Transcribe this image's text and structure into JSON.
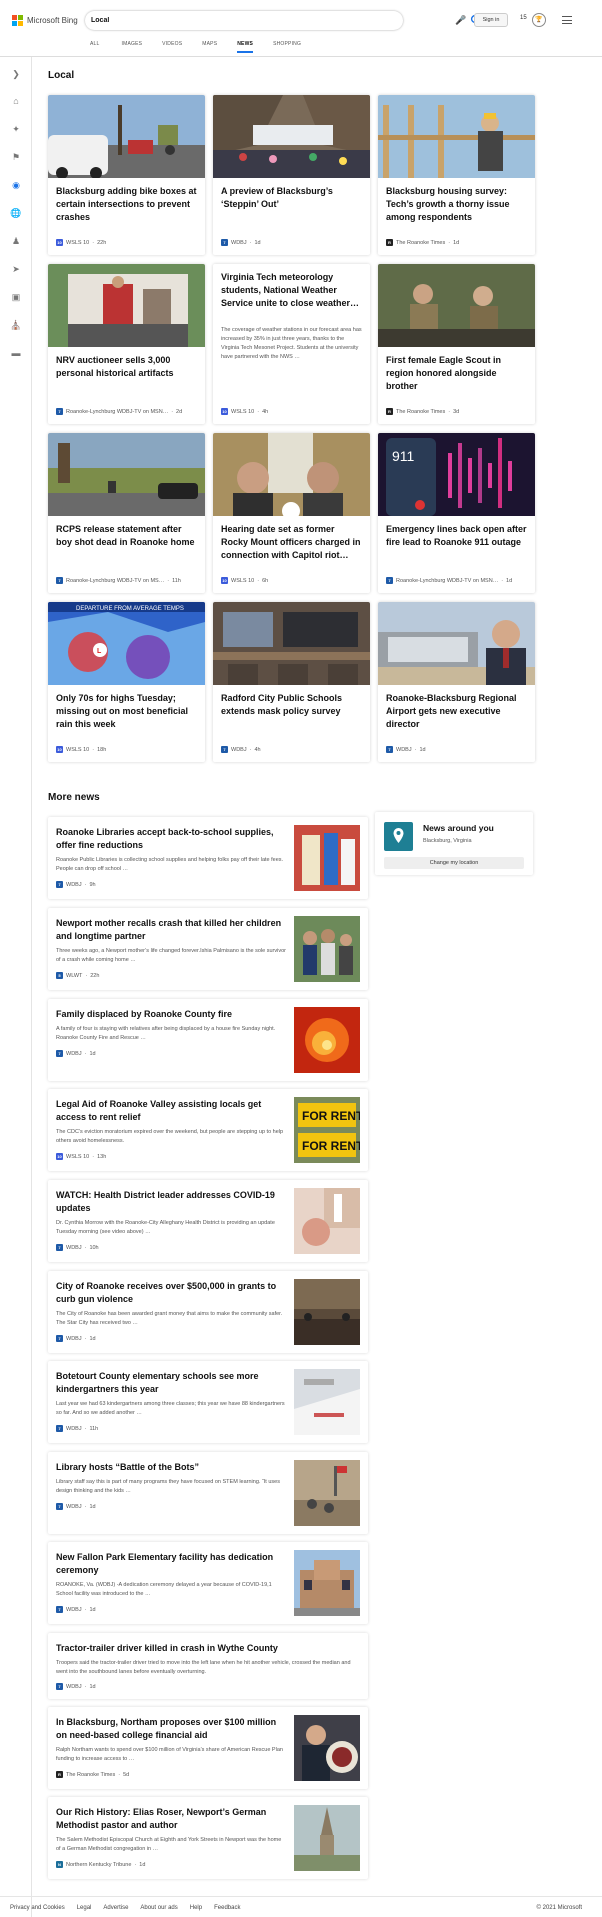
{
  "header": {
    "brand": "Microsoft Bing",
    "query": "Local",
    "signin_label": "Sign in",
    "rewards_count": "15"
  },
  "tabs": [
    "ALL",
    "IMAGES",
    "VIDEOS",
    "MAPS",
    "NEWS",
    "SHOPPING"
  ],
  "active_tab": "NEWS",
  "sidebar": [
    "chevron-right-icon",
    "home-icon",
    "sparkle-icon",
    "flag-icon",
    "location-pin-icon",
    "globe-icon",
    "person-icon",
    "rocket-icon",
    "film-icon",
    "bank-icon",
    "card-icon"
  ],
  "local": {
    "title": "Local",
    "cards": [
      {
        "title": "Blacksburg adding bike boxes at certain intersections to prevent crashes",
        "source": "WSLS 10",
        "time": "22h"
      },
      {
        "title": "A preview of Blacksburg’s ‘Steppin’ Out’",
        "source": "WDBJ",
        "time": "1d"
      },
      {
        "title": "Blacksburg housing survey: Tech’s growth a thorny issue among respondents",
        "source": "The Roanoke Times",
        "time": "1d"
      },
      {
        "title": "NRV auctioneer sells 3,000 personal historical artifacts",
        "source": "Roanoke-Lynchburg WDBJ-TV on MSN…",
        "time": "2d"
      },
      {
        "title": "Virginia Tech meteorology students, National Weather Service unite to close weather…",
        "description": "The coverage of weather stations in our forecast area has increased by 35% in just three years, thanks to the Virginia Tech Mesonet Project. Students at the university have partnered with the NWS …",
        "source": "WSLS 10",
        "time": "4h"
      },
      {
        "title": "First female Eagle Scout in region honored alongside brother",
        "source": "The Roanoke Times",
        "time": "3d"
      },
      {
        "title": "RCPS release statement after boy shot dead in Roanoke home",
        "source": "Roanoke-Lynchburg WDBJ-TV on MS…",
        "time": "11h"
      },
      {
        "title": "Hearing date set as former Rocky Mount officers charged in connection with Capitol riot…",
        "source": "WSLS 10",
        "time": "6h"
      },
      {
        "title": "Emergency lines back open after fire lead to Roanoke 911 outage",
        "source": "Roanoke-Lynchburg WDBJ-TV on MSN…",
        "time": "1d"
      },
      {
        "title": "Only 70s for highs Tuesday; missing out on most beneficial rain this week",
        "source": "WSLS 10",
        "time": "18h",
        "image_text": "DEPARTURE FROM AVERAGE TEMPS"
      },
      {
        "title": "Radford City Public Schools extends mask policy survey",
        "source": "WDBJ",
        "time": "4h"
      },
      {
        "title": "Roanoke-Blacksburg Regional Airport gets new executive director",
        "source": "WDBJ",
        "time": "1d"
      }
    ]
  },
  "more": {
    "title": "More news",
    "items": [
      {
        "title": "Roanoke Libraries accept back-to-school supplies, offer fine reductions",
        "description": "Roanoke Public Libraries is collecting school supplies and helping folks pay off their late fees. People can drop off school …",
        "source": "WDBJ",
        "time": "9h"
      },
      {
        "title": "Newport mother recalls crash that killed her children and longtime partner",
        "description": "Three weeks ago, a Newport mother’s life changed forever.Ishia Palmisano is the sole survivor of a crash while coming home …",
        "source": "WLWT",
        "time": "22h"
      },
      {
        "title": "Family displaced by Roanoke County fire",
        "description": "A family of four is staying with relatives after being displaced by a house fire Sunday night. Roanoke County Fire and Rescue …",
        "source": "WDBJ",
        "time": "1d"
      },
      {
        "title": "Legal Aid of Roanoke Valley assisting locals get access to rent relief",
        "description": "The CDC’s eviction moratorium expired over the weekend, but people are stepping up to help others avoid homelessness.",
        "source": "WSLS 10",
        "time": "13h",
        "image_text": "FOR RENT"
      },
      {
        "title": "WATCH: Health District leader addresses COVID-19 updates",
        "description": "Dr. Cynthia Morrow with the Roanoke-City Alleghany Health District is providing an update Tuesday morning (see video above) …",
        "source": "WDBJ",
        "time": "10h"
      },
      {
        "title": "City of Roanoke receives over $500,000 in grants to curb gun violence",
        "description": "The City of Roanoke has been awarded grant money that aims to make the community safer. The Star City has received two …",
        "source": "WDBJ",
        "time": "1d"
      },
      {
        "title": "Botetourt County elementary schools see more kindergartners this year",
        "description": "Last year we had 63 kindergartners among three classes; this year we have 88 kindergartners so far. And so we added another …",
        "source": "WDBJ",
        "time": "11h"
      },
      {
        "title": "Library hosts “Battle of the Bots”",
        "description": "Library staff say this is part of many programs they have focused on STEM learning. “It uses design thinking and the kids …",
        "source": "WDBJ",
        "time": "1d"
      },
      {
        "title": "New Fallon Park Elementary facility has dedication ceremony",
        "description": "ROANOKE, Va. (WDBJ) -A dedication ceremony delayed a year because of COVID-19,1 School facility was introduced to the …",
        "source": "WDBJ",
        "time": "1d"
      },
      {
        "title": "Tractor-trailer driver killed in crash in Wythe County",
        "description": "Troopers said the tractor-trailer driver tried to move into the left lane when he hit another vehicle, crossed the median and went into the southbound lanes before eventually overturning.",
        "source": "WDBJ",
        "time": "1d"
      },
      {
        "title": "In Blacksburg, Northam proposes over $100 million on need-based college financial aid",
        "description": "Ralph Northam wants to spend over $100 million of Virginia’s share of American Rescue Plan funding to increase access to …",
        "source": "The Roanoke Times",
        "time": "5d"
      },
      {
        "title": "Our Rich History: Elias Roser, Newport’s German Methodist pastor and author",
        "description": "The Salem Methodist Episcopal Church at Eighth and York Streets in Newport was the home of a German Methodist congregation in …",
        "source": "Northern Kentucky Tribune",
        "time": "1d"
      }
    ]
  },
  "news_around": {
    "title": "News around you",
    "location": "Blacksburg, Virginia",
    "button": "Change my location"
  },
  "footer": {
    "links": [
      "Privacy and Cookies",
      "Legal",
      "Advertise",
      "About our ads",
      "Help",
      "Feedback"
    ],
    "copyright": "© 2021 Microsoft"
  },
  "colors": {
    "accent": "#1a73e8",
    "wsls": "#3b5bdb",
    "wdbj": "#1e5aa8",
    "roanoke_times": "#222222"
  }
}
